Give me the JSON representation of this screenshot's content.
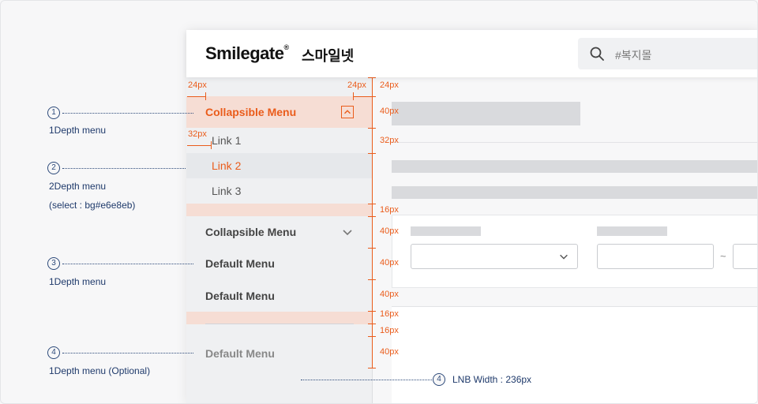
{
  "header": {
    "logo": "Smilegate",
    "logo_mark": "®",
    "logo_kr": "스마일넷",
    "search_placeholder": "#복지몰"
  },
  "lnb": {
    "collapsible_active": "Collapsible Menu",
    "links": [
      "Link 1",
      "Link 2",
      "Link 3"
    ],
    "collapsible_closed": "Collapsible Menu",
    "default_1": "Default Menu",
    "default_2": "Default Menu",
    "default_optional": "Default Menu"
  },
  "content": {
    "tilde": "~"
  },
  "annotations": {
    "n1": "1",
    "t1": "1Depth menu",
    "n2": "2",
    "t2": "2Depth menu",
    "t2b": "(select : bg#e6e8eb)",
    "n3": "3",
    "t3": "1Depth menu",
    "n4": "4",
    "t4": "1Depth menu (Optional)",
    "n5": "4",
    "t5": "LNB Width : 236px"
  },
  "dimensions": {
    "d24a": "24px",
    "d24b": "24px",
    "d24c": "24px",
    "d32a": "32px",
    "d40a": "40px",
    "d32b": "32px",
    "d16a": "16px",
    "d40b": "40px",
    "d40c": "40px",
    "d40d": "40px",
    "d16b": "16px",
    "d16c": "16px",
    "d40e": "40px"
  },
  "colors": {
    "accent": "#ea5c1b",
    "active_bg": "#f6ddd4",
    "select_bg": "#e6e8eb",
    "lnb_bg": "#eff0f2",
    "annotation": "#1f3a6b"
  }
}
